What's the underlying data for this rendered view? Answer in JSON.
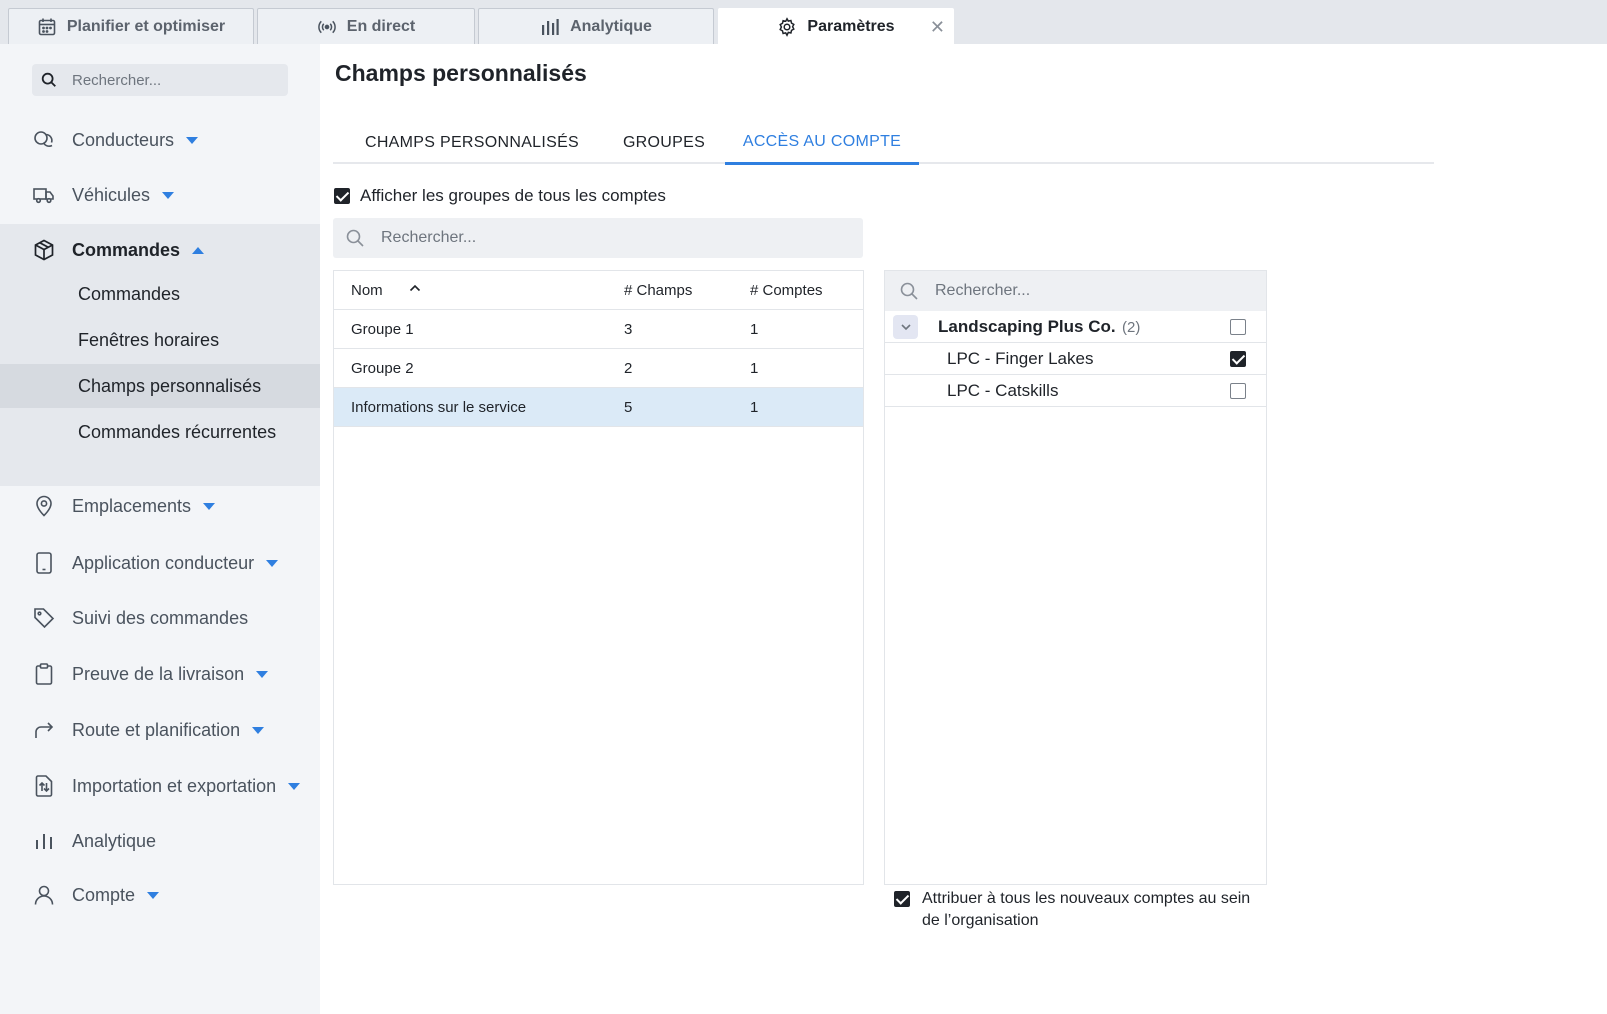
{
  "top_tabs": [
    {
      "label": "Planifier et optimiser",
      "icon": "calendar-icon"
    },
    {
      "label": "En direct",
      "icon": "broadcast-icon"
    },
    {
      "label": "Analytique",
      "icon": "bar-chart-icon"
    },
    {
      "label": "Paramètres",
      "icon": "gear-icon",
      "active": true,
      "close_symbol": "✕"
    }
  ],
  "sidebar": {
    "search_placeholder": "Rechercher...",
    "items": [
      {
        "label": "Conducteurs",
        "icon": "drivers-icon",
        "caret": "down"
      },
      {
        "label": "Véhicules",
        "icon": "truck-icon",
        "caret": "down"
      },
      {
        "label": "Commandes",
        "icon": "box-icon",
        "caret": "up",
        "expanded": true,
        "children": [
          "Commandes",
          "Fenêtres horaires",
          "Champs personnalisés",
          "Commandes récurrentes"
        ],
        "selected_child": "Champs personnalisés"
      },
      {
        "label": "Emplacements",
        "icon": "location-pin-icon",
        "caret": "down"
      },
      {
        "label": "Application conducteur",
        "icon": "phone-icon",
        "caret": "down"
      },
      {
        "label": "Suivi des commandes",
        "icon": "tag-icon",
        "caret": "none"
      },
      {
        "label": "Preuve de la livraison",
        "icon": "clipboard-icon",
        "caret": "down"
      },
      {
        "label": "Route et planification",
        "icon": "route-arrow-icon",
        "caret": "down"
      },
      {
        "label": "Importation et exportation",
        "icon": "import-export-icon",
        "caret": "down"
      },
      {
        "label": "Analytique",
        "icon": "bar-chart-icon",
        "caret": "none"
      },
      {
        "label": "Compte",
        "icon": "user-icon",
        "caret": "down"
      }
    ]
  },
  "main": {
    "title": "Champs personnalisés",
    "tabs": [
      {
        "label": "CHAMPS PERSONNALISÉS",
        "active": false
      },
      {
        "label": "GROUPES",
        "active": false
      },
      {
        "label": "ACCÈS AU COMPTE",
        "active": true
      }
    ],
    "show_all_groups": {
      "label": "Afficher les groupes de tous les comptes",
      "checked": true
    },
    "search_placeholder": "Rechercher...",
    "groups_table": {
      "headers": [
        "Nom",
        "# Champs",
        "# Comptes"
      ],
      "sort": "ascending",
      "rows": [
        {
          "name": "Groupe 1",
          "fields": "3",
          "accounts": "1",
          "selected": false
        },
        {
          "name": "Groupe 2",
          "fields": "2",
          "accounts": "1",
          "selected": false
        },
        {
          "name": "Informations sur le service",
          "fields": "5",
          "accounts": "1",
          "selected": true
        }
      ]
    },
    "accounts_panel": {
      "search_placeholder": "Rechercher...",
      "parent": {
        "name": "Landscaping Plus Co.",
        "count": "(2)",
        "checked": false,
        "expanded": true
      },
      "children": [
        {
          "name": "LPC - Finger Lakes",
          "checked": true
        },
        {
          "name": "LPC - Catskills",
          "checked": false
        }
      ]
    },
    "assign_new_accounts": {
      "label": "Attribuer à tous les nouveaux comptes au sein de l’organisation",
      "checked": true
    }
  },
  "colors": {
    "accent": "#2f7fe0",
    "sidebar_bg": "#f3f5f8",
    "selected_row": "#dbeaf7",
    "expanded_section_bg": "#e5e8ed"
  }
}
